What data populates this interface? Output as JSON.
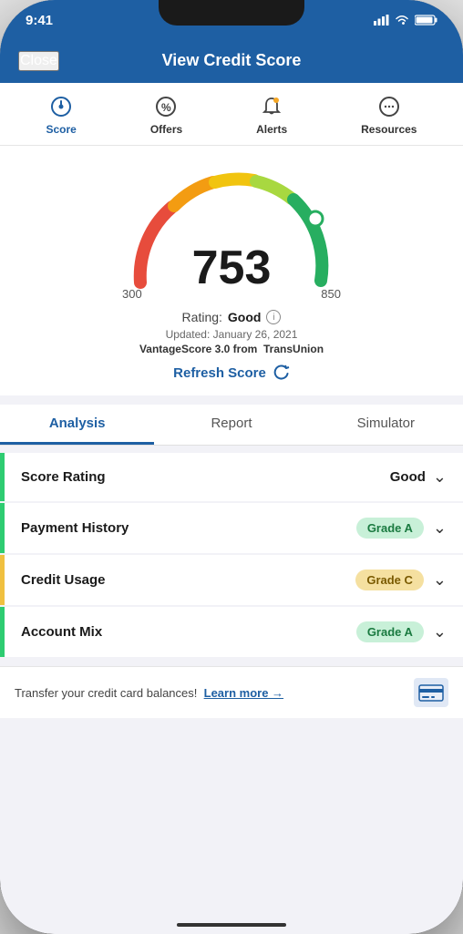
{
  "status_bar": {
    "time": "9:41"
  },
  "header": {
    "close_label": "Close",
    "title": "View Credit Score"
  },
  "nav": {
    "tabs": [
      {
        "id": "score",
        "label": "Score",
        "active": true
      },
      {
        "id": "offers",
        "label": "Offers",
        "active": false
      },
      {
        "id": "alerts",
        "label": "Alerts",
        "active": false
      },
      {
        "id": "resources",
        "label": "Resources",
        "active": false
      }
    ]
  },
  "score": {
    "value": "753",
    "min": "300",
    "max": "850",
    "rating_label": "Rating:",
    "rating_value": "Good",
    "updated_text": "Updated: January 26, 2021",
    "vantage_text": "VantageScore 3.0 from",
    "vantage_provider": "TransUnion",
    "refresh_label": "Refresh Score"
  },
  "analysis": {
    "tabs": [
      {
        "label": "Analysis",
        "active": true
      },
      {
        "label": "Report",
        "active": false
      },
      {
        "label": "Simulator",
        "active": false
      }
    ],
    "items": [
      {
        "label": "Score Rating",
        "value": "Good",
        "badge": null,
        "badge_type": null,
        "border_color": "green"
      },
      {
        "label": "Payment History",
        "value": null,
        "badge": "Grade A",
        "badge_type": "green",
        "border_color": "green"
      },
      {
        "label": "Credit Usage",
        "value": null,
        "badge": "Grade C",
        "badge_type": "yellow",
        "border_color": "yellow"
      },
      {
        "label": "Account Mix",
        "value": null,
        "badge": "Grade A",
        "badge_type": "green",
        "border_color": "green"
      }
    ]
  },
  "banner": {
    "text": "Transfer your credit card balances!",
    "link_text": "Learn more →"
  }
}
